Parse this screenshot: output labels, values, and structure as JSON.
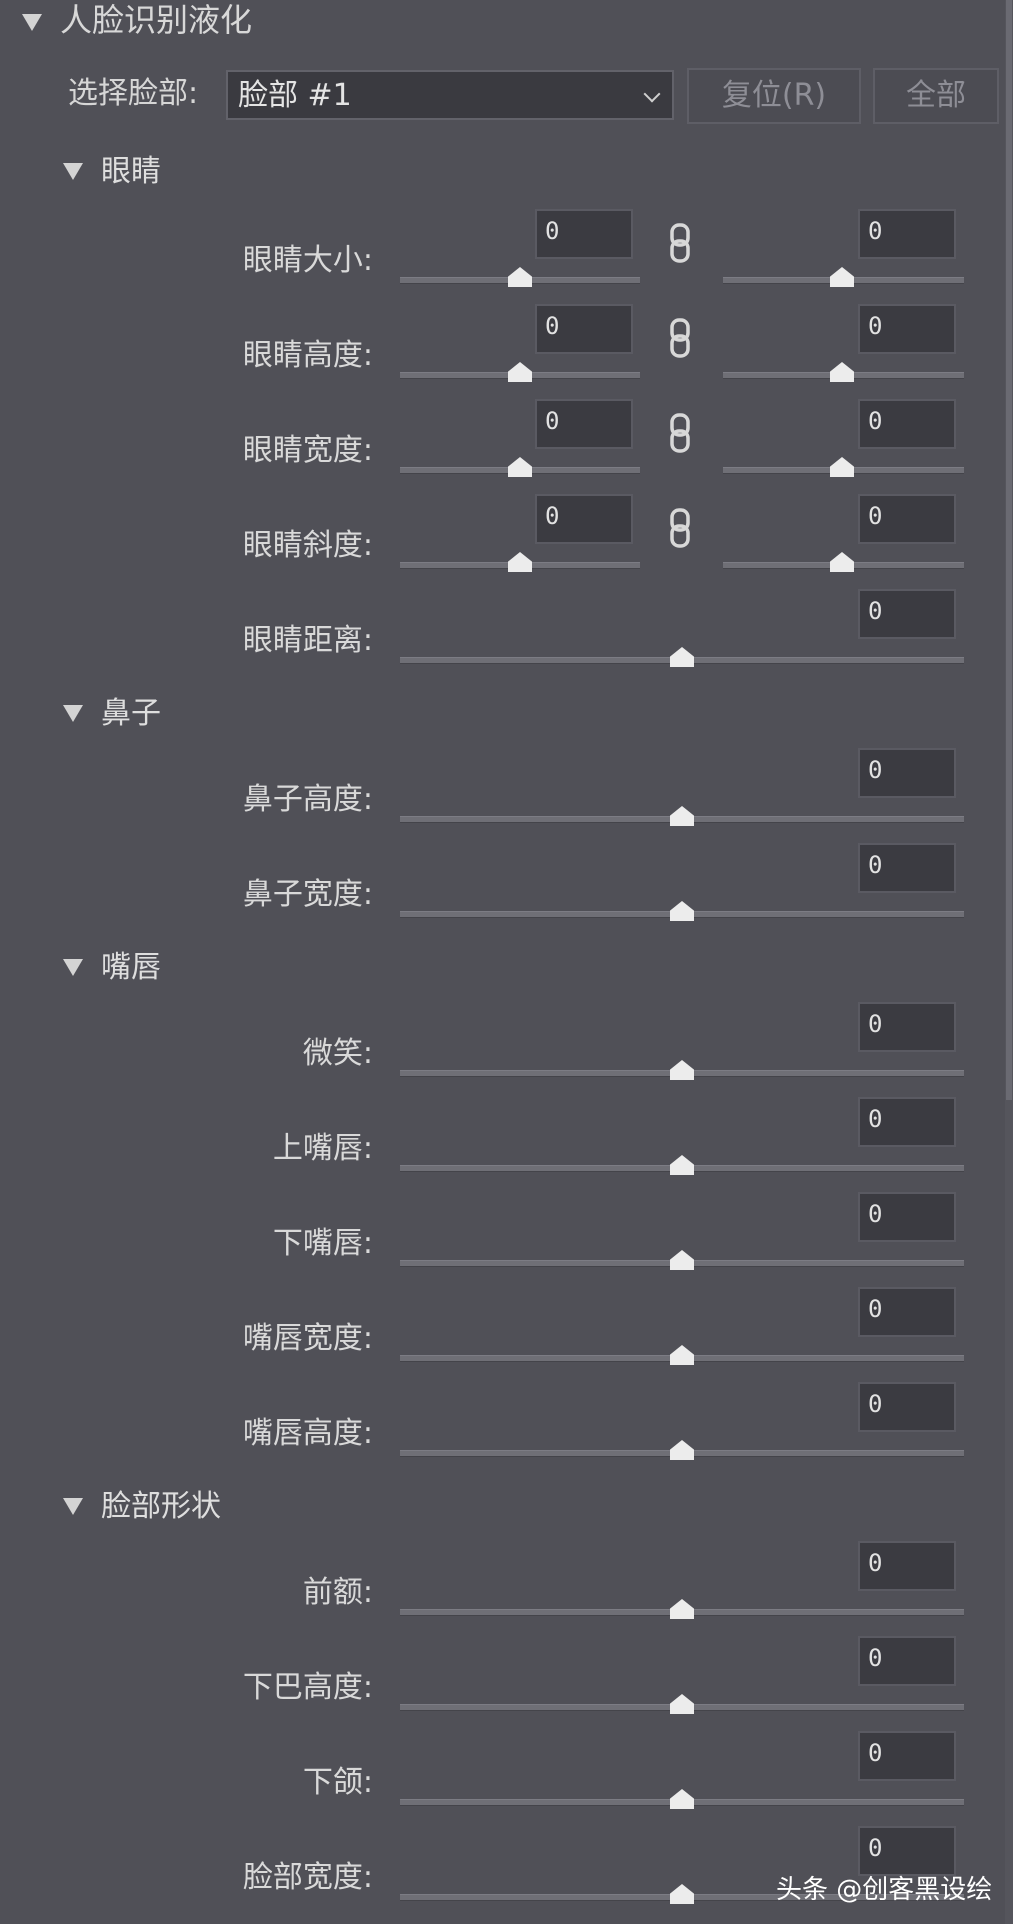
{
  "panel": {
    "title": "人脸识别液化",
    "select_label": "选择脸部:",
    "select_value": "脸部  #1",
    "reset_label": "复位(R)",
    "all_label": "全部"
  },
  "eyes": {
    "title": "眼睛",
    "rows": [
      {
        "label": "眼睛大小:",
        "left": "0",
        "right": "0"
      },
      {
        "label": "眼睛高度:",
        "left": "0",
        "right": "0"
      },
      {
        "label": "眼睛宽度:",
        "left": "0",
        "right": "0"
      },
      {
        "label": "眼睛斜度:",
        "left": "0",
        "right": "0"
      }
    ],
    "distance": {
      "label": "眼睛距离:",
      "value": "0"
    }
  },
  "nose": {
    "title": "鼻子",
    "rows": [
      {
        "label": "鼻子高度:",
        "value": "0"
      },
      {
        "label": "鼻子宽度:",
        "value": "0"
      }
    ]
  },
  "mouth": {
    "title": "嘴唇",
    "rows": [
      {
        "label": "微笑:",
        "value": "0"
      },
      {
        "label": "上嘴唇:",
        "value": "0"
      },
      {
        "label": "下嘴唇:",
        "value": "0"
      },
      {
        "label": "嘴唇宽度:",
        "value": "0"
      },
      {
        "label": "嘴唇高度:",
        "value": "0"
      }
    ]
  },
  "face_shape": {
    "title": "脸部形状",
    "rows": [
      {
        "label": "前额:",
        "value": "0"
      },
      {
        "label": "下巴高度:",
        "value": "0"
      },
      {
        "label": "下颌:",
        "value": "0"
      },
      {
        "label": "脸部宽度:",
        "value": "0"
      }
    ]
  },
  "watermark": "头条 @创客黑设绘",
  "colors": {
    "background": "#505057",
    "field": "#3b3b41",
    "thumb": "#ececec",
    "track": "#6f6f76"
  },
  "icons": {
    "caret": "triangle-down-icon",
    "link": "chain-link-icon",
    "dropdown": "chevron-down-icon"
  }
}
